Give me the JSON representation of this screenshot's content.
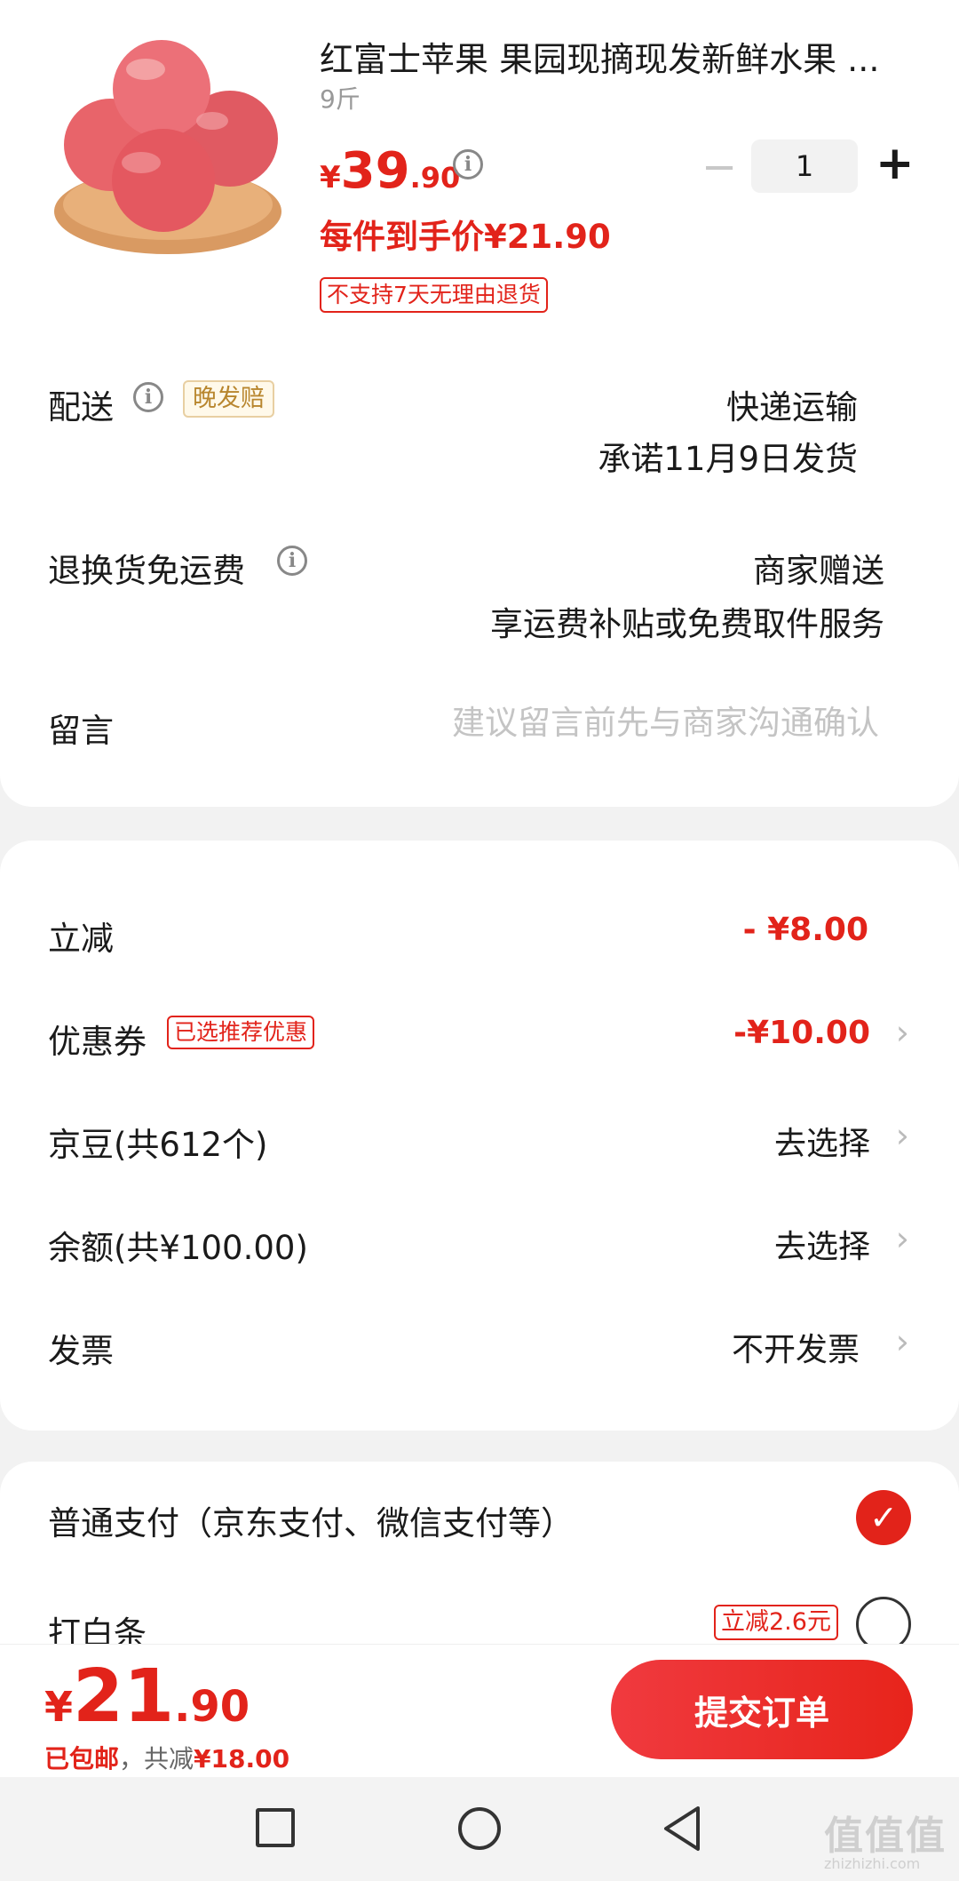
{
  "product": {
    "title": "红富士苹果 果园现摘现发新鲜水果 ...",
    "spec": "9斤",
    "price_currency": "¥",
    "price_int": "39",
    "price_dec": ".90",
    "deal_price": "每件到手价¥21.90",
    "return_tag": "不支持7天无理由退货",
    "quantity": "1",
    "minus": "−",
    "plus": "+"
  },
  "delivery": {
    "label": "配送",
    "late_tag": "晚发赔",
    "method": "快递运输",
    "date": "承诺11月9日发货"
  },
  "return_shipping": {
    "label": "退换货免运费",
    "line1": "商家赠送",
    "line2": "享运费补贴或免费取件服务"
  },
  "message": {
    "label": "留言",
    "placeholder": "建议留言前先与商家沟通确认"
  },
  "discounts": {
    "instant": {
      "label": "立减",
      "value": "- ¥8.00"
    },
    "coupon": {
      "label": "优惠券",
      "tag": "已选推荐优惠",
      "value": "-¥10.00"
    },
    "jingdou": {
      "label": "京豆(共612个)",
      "value": "去选择"
    },
    "balance": {
      "label": "余额(共¥100.00)",
      "value": "去选择"
    },
    "invoice": {
      "label": "发票",
      "value": "不开发票"
    }
  },
  "payment": {
    "normal": {
      "label": "普通支付（京东支付、微信支付等）",
      "checked": true
    },
    "baitiao": {
      "label": "打白条",
      "tag": "立减2.6元",
      "checked": false
    }
  },
  "bottom": {
    "currency": "¥",
    "total_int": "21",
    "total_dec": ".90",
    "shipping_note": "已包邮",
    "sep": "，",
    "saved_label": "共减",
    "saved_value": "¥18.00",
    "submit_label": "提交订单"
  },
  "watermark": {
    "text": "值值值",
    "url": "zhizhizhi.com"
  },
  "colors": {
    "accent": "#e2231a",
    "late_tag": "#b8862e"
  }
}
